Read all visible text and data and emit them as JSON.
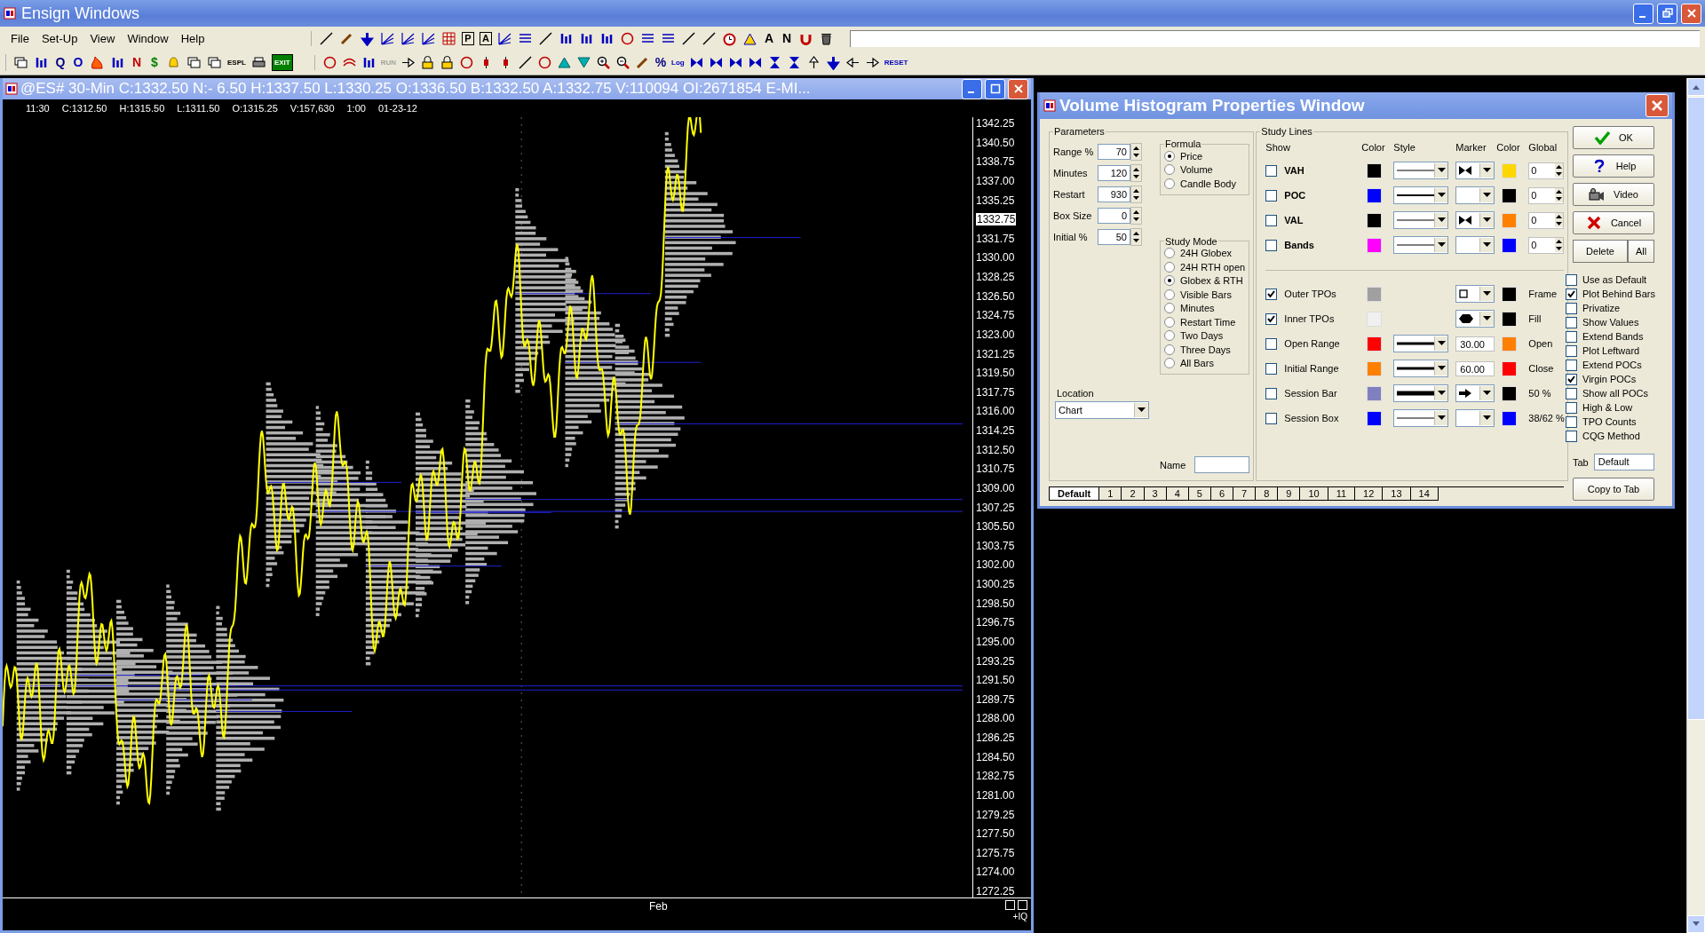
{
  "app": {
    "title": "Ensign Windows",
    "menu": [
      "File",
      "Set-Up",
      "View",
      "Window",
      "Help"
    ]
  },
  "toolbar_top": [
    {
      "kind": "line"
    },
    {
      "kind": "pencil"
    },
    {
      "kind": "arrow-down"
    },
    {
      "kind": "fan"
    },
    {
      "kind": "fan"
    },
    {
      "kind": "fan"
    },
    {
      "kind": "grid"
    },
    {
      "kind": "boxed",
      "label": "P"
    },
    {
      "kind": "boxed",
      "label": "A"
    },
    {
      "kind": "fan"
    },
    {
      "kind": "lines"
    },
    {
      "kind": "line"
    },
    {
      "kind": "bars"
    },
    {
      "kind": "bars"
    },
    {
      "kind": "bars"
    },
    {
      "kind": "circle"
    },
    {
      "kind": "lines"
    },
    {
      "kind": "lines"
    },
    {
      "kind": "line"
    },
    {
      "kind": "line"
    },
    {
      "kind": "clock"
    },
    {
      "kind": "triangle"
    },
    {
      "kind": "letter",
      "label": "A",
      "color": "#000000"
    },
    {
      "kind": "letter",
      "label": "N",
      "color": "#000000"
    },
    {
      "kind": "magnet"
    },
    {
      "kind": "trash"
    }
  ],
  "toolbar_left": [
    {
      "kind": "window"
    },
    {
      "kind": "bars"
    },
    {
      "kind": "letter",
      "label": "Q",
      "color": "#000080"
    },
    {
      "kind": "letter",
      "label": "O",
      "color": "#0000c0"
    },
    {
      "kind": "fire"
    },
    {
      "kind": "bars"
    },
    {
      "kind": "letter",
      "label": "N",
      "color": "#c00000"
    },
    {
      "kind": "letter",
      "label": "$",
      "color": "#008000"
    },
    {
      "kind": "bell"
    },
    {
      "kind": "window"
    },
    {
      "kind": "window"
    },
    {
      "kind": "letter",
      "label": "ESPL",
      "color": "#000000"
    },
    {
      "kind": "printer"
    },
    {
      "kind": "letter",
      "label": "EXIT",
      "color": "#008000"
    }
  ],
  "toolbar_right": [
    {
      "kind": "circle"
    },
    {
      "kind": "waves"
    },
    {
      "kind": "bars"
    },
    {
      "kind": "letter",
      "label": "RUN",
      "color": "#a0a0a0"
    },
    {
      "kind": "arrow-right"
    },
    {
      "kind": "lock"
    },
    {
      "kind": "lock"
    },
    {
      "kind": "circle"
    },
    {
      "kind": "candle"
    },
    {
      "kind": "candle"
    },
    {
      "kind": "line"
    },
    {
      "kind": "circle"
    },
    {
      "kind": "tri-up"
    },
    {
      "kind": "tri-down"
    },
    {
      "kind": "zoom-in"
    },
    {
      "kind": "zoom-out"
    },
    {
      "kind": "pencil"
    },
    {
      "kind": "letter",
      "label": "%",
      "color": "#000080"
    },
    {
      "kind": "letter",
      "label": "Log",
      "color": "#0000c0"
    },
    {
      "kind": "bowtie"
    },
    {
      "kind": "bowtie"
    },
    {
      "kind": "bowtie"
    },
    {
      "kind": "bowtie"
    },
    {
      "kind": "hourglass"
    },
    {
      "kind": "hourglass"
    },
    {
      "kind": "arrow-up"
    },
    {
      "kind": "arrow-down"
    },
    {
      "kind": "arrow-left"
    },
    {
      "kind": "arrow-right"
    },
    {
      "kind": "letter",
      "label": "RESET",
      "color": "#0000c0"
    }
  ],
  "chart": {
    "title": "@ES# 30-Min C:1332.50 N:- 6.50 H:1337.50 L:1330.25 O:1336.50 B:1332.50 A:1332.75 V:110094 OI:2671854 E-MI...",
    "info": [
      "11:30",
      "C:1312.50",
      "H:1315.50",
      "L:1311.50",
      "O:1315.25",
      "V:157,630",
      "1:00",
      "01-23-12"
    ],
    "axis": [
      {
        "text": "1342.25",
        "current": false
      },
      {
        "text": "1340.50",
        "current": false
      },
      {
        "text": "1338.75",
        "current": false
      },
      {
        "text": "1337.00",
        "current": false
      },
      {
        "text": "1335.25",
        "current": false
      },
      {
        "text": "1332.75",
        "current": true
      },
      {
        "text": "1331.75",
        "current": false
      },
      {
        "text": "1330.00",
        "current": false
      },
      {
        "text": "1328.25",
        "current": false
      },
      {
        "text": "1326.50",
        "current": false
      },
      {
        "text": "1324.75",
        "current": false
      },
      {
        "text": "1323.00",
        "current": false
      },
      {
        "text": "1321.25",
        "current": false
      },
      {
        "text": "1319.50",
        "current": false
      },
      {
        "text": "1317.75",
        "current": false
      },
      {
        "text": "1316.00",
        "current": false
      },
      {
        "text": "1314.25",
        "current": false
      },
      {
        "text": "1312.50",
        "current": false
      },
      {
        "text": "1310.75",
        "current": false
      },
      {
        "text": "1309.00",
        "current": false
      },
      {
        "text": "1307.25",
        "current": false
      },
      {
        "text": "1305.50",
        "current": false
      },
      {
        "text": "1303.75",
        "current": false
      },
      {
        "text": "1302.00",
        "current": false
      },
      {
        "text": "1300.25",
        "current": false
      },
      {
        "text": "1298.50",
        "current": false
      },
      {
        "text": "1296.75",
        "current": false
      },
      {
        "text": "1295.00",
        "current": false
      },
      {
        "text": "1293.25",
        "current": false
      },
      {
        "text": "1291.50",
        "current": false
      },
      {
        "text": "1289.75",
        "current": false
      },
      {
        "text": "1288.00",
        "current": false
      },
      {
        "text": "1286.25",
        "current": false
      },
      {
        "text": "1284.50",
        "current": false
      },
      {
        "text": "1282.75",
        "current": false
      },
      {
        "text": "1281.00",
        "current": false
      },
      {
        "text": "1279.25",
        "current": false
      },
      {
        "text": "1277.50",
        "current": false
      },
      {
        "text": "1275.75",
        "current": false
      },
      {
        "text": "1274.00",
        "current": false
      },
      {
        "text": "1272.25",
        "current": false
      }
    ],
    "x_label": "Feb",
    "corner": "+IQ"
  },
  "dialog": {
    "title": "Volume Histogram Properties Window",
    "parameters": {
      "title": "Parameters",
      "fields": [
        {
          "label": "Range %",
          "value": "70"
        },
        {
          "label": "Minutes",
          "value": "120"
        },
        {
          "label": "Restart",
          "value": "930"
        },
        {
          "label": "Box Size",
          "value": "0"
        },
        {
          "label": "Initial %",
          "value": "50"
        }
      ]
    },
    "formula": {
      "title": "Formula",
      "options": [
        {
          "label": "Price",
          "selected": true
        },
        {
          "label": "Volume",
          "selected": false
        },
        {
          "label": "Candle Body",
          "selected": false
        }
      ]
    },
    "study_mode": {
      "title": "Study Mode",
      "options": [
        {
          "label": "24H Globex",
          "selected": false
        },
        {
          "label": "24H RTH open",
          "selected": false
        },
        {
          "label": "Globex & RTH",
          "selected": true
        },
        {
          "label": "Visible Bars",
          "selected": false
        },
        {
          "label": "Minutes",
          "selected": false
        },
        {
          "label": "Restart Time",
          "selected": false
        },
        {
          "label": "Two Days",
          "selected": false
        },
        {
          "label": "Three Days",
          "selected": false
        },
        {
          "label": "All Bars",
          "selected": false
        }
      ]
    },
    "location": {
      "label": "Location",
      "value": "Chart"
    },
    "name_label": "Name",
    "study_lines": {
      "title": "Study Lines",
      "headers": [
        "Show",
        "Color",
        "Style",
        "Marker",
        "Color",
        "Global"
      ],
      "lines": [
        {
          "label": "VAH",
          "checked": false,
          "swatches": [
            {
              "color": "#000000"
            },
            {
              "color": "#ffd700"
            }
          ],
          "global": "0"
        },
        {
          "label": "POC",
          "checked": false,
          "swatches": [
            {
              "color": "#0000ff"
            },
            {
              "color": "#000000"
            }
          ],
          "global": "0"
        },
        {
          "label": "VAL",
          "checked": false,
          "swatches": [
            {
              "color": "#000000"
            },
            {
              "color": "#ff8000"
            }
          ],
          "global": "0"
        },
        {
          "label": "Bands",
          "checked": false,
          "swatches": [
            {
              "color": "#ff00ff"
            },
            {
              "color": "#0000ff"
            }
          ],
          "global": "0"
        }
      ],
      "extras": [
        {
          "label": "Outer TPOs",
          "checked": true,
          "swatches": [
            {
              "color": "#a0a0a0"
            },
            {
              "color": "#000000"
            }
          ],
          "note": "Frame"
        },
        {
          "label": "Inner TPOs",
          "checked": true,
          "swatches": [
            {
              "color": "#f0f0f0"
            },
            {
              "color": "#000000"
            }
          ],
          "note": "Fill"
        },
        {
          "label": "Open Range",
          "checked": false,
          "swatches": [
            {
              "color": "#ff0000"
            },
            {
              "color": "#ff8000"
            }
          ],
          "value": "30.00",
          "note": "Open"
        },
        {
          "label": "Initial Range",
          "checked": false,
          "swatches": [
            {
              "color": "#ff8000"
            },
            {
              "color": "#ff0000"
            }
          ],
          "value": "60.00",
          "note": "Close"
        },
        {
          "label": "Session Bar",
          "checked": false,
          "swatches": [
            {
              "color": "#8080c0"
            },
            {
              "color": "#000000"
            }
          ],
          "note": "50 %"
        },
        {
          "label": "Session Box",
          "checked": false,
          "swatches": [
            {
              "color": "#0000ff"
            },
            {
              "color": "#0000ff"
            }
          ],
          "note": "38/62 %"
        }
      ]
    },
    "tabs": [
      {
        "label": "Default",
        "selected": true
      },
      {
        "label": "1",
        "selected": false
      },
      {
        "label": "2",
        "selected": false
      },
      {
        "label": "3",
        "selected": false
      },
      {
        "label": "4",
        "selected": false
      },
      {
        "label": "5",
        "selected": false
      },
      {
        "label": "6",
        "selected": false
      },
      {
        "label": "7",
        "selected": false
      },
      {
        "label": "8",
        "selected": false
      },
      {
        "label": "9",
        "selected": false
      },
      {
        "label": "10",
        "selected": false
      },
      {
        "label": "11",
        "selected": false
      },
      {
        "label": "12",
        "selected": false
      },
      {
        "label": "13",
        "selected": false
      },
      {
        "label": "14",
        "selected": false
      }
    ],
    "buttons": [
      {
        "kind": "ok",
        "label": "OK"
      },
      {
        "kind": "help",
        "label": "Help"
      },
      {
        "kind": "video",
        "label": "Video"
      },
      {
        "kind": "cancel",
        "label": "Cancel"
      }
    ],
    "delete_buttons": [
      "Delete",
      "All"
    ],
    "options": [
      {
        "label": "Use as Default",
        "checked": false
      },
      {
        "label": "Plot Behind Bars",
        "checked": true
      },
      {
        "label": "Privatize",
        "checked": false
      },
      {
        "label": "Show Values",
        "checked": false
      },
      {
        "label": "Extend Bands",
        "checked": false
      },
      {
        "label": "Plot Leftward",
        "checked": false
      },
      {
        "label": "Extend POCs",
        "checked": false
      },
      {
        "label": "Virgin POCs",
        "checked": true
      },
      {
        "label": "Show all POCs",
        "checked": false
      },
      {
        "label": "High & Low",
        "checked": false
      },
      {
        "label": "TPO Counts",
        "checked": false
      },
      {
        "label": "CQG Method",
        "checked": false
      }
    ],
    "tab_field": {
      "label": "Tab",
      "value": "Default"
    },
    "copy_button": "Copy to Tab"
  }
}
